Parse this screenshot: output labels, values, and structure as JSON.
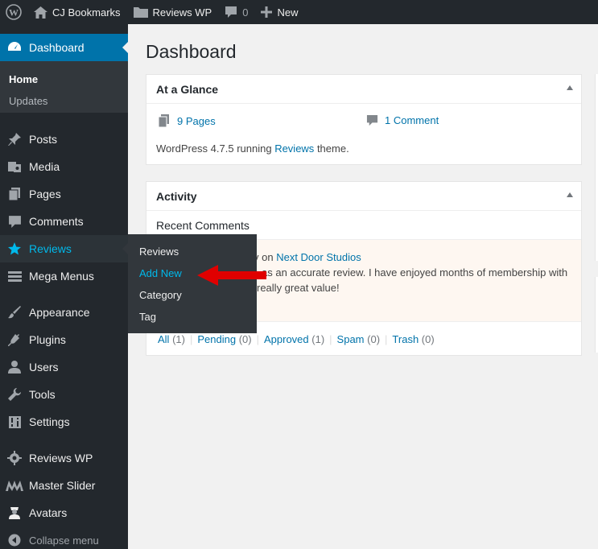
{
  "admin_bar": {
    "site_name": "CJ Bookmarks",
    "plugin_name": "Reviews WP",
    "comment_count": "0",
    "new_label": "New"
  },
  "sidebar": {
    "dashboard": "Dashboard",
    "submenu": {
      "home": "Home",
      "updates": "Updates"
    },
    "items": [
      {
        "label": "Posts",
        "icon": "pin-icon"
      },
      {
        "label": "Media",
        "icon": "media-icon"
      },
      {
        "label": "Pages",
        "icon": "pages-icon"
      },
      {
        "label": "Comments",
        "icon": "comment-icon"
      },
      {
        "label": "Reviews",
        "icon": "star-icon"
      },
      {
        "label": "Mega Menus",
        "icon": "menu-icon"
      },
      {
        "label": "Appearance",
        "icon": "brush-icon"
      },
      {
        "label": "Plugins",
        "icon": "plug-icon"
      },
      {
        "label": "Users",
        "icon": "user-icon"
      },
      {
        "label": "Tools",
        "icon": "wrench-icon"
      },
      {
        "label": "Settings",
        "icon": "settings-icon"
      },
      {
        "label": "Reviews WP",
        "icon": "gear-icon"
      },
      {
        "label": "Master Slider",
        "icon": "slider-icon"
      },
      {
        "label": "Avatars",
        "icon": "avatar-icon"
      }
    ],
    "collapse": "Collapse menu"
  },
  "flyout": {
    "items": [
      "Reviews",
      "Add New",
      "Category",
      "Tag"
    ]
  },
  "main": {
    "title": "Dashboard",
    "glance": {
      "title": "At a Glance",
      "pages": "9 Pages",
      "comments": "1 Comment",
      "version_text": "WordPress 4.7.5 running",
      "theme_link": "Reviews",
      "theme_suffix": "theme."
    },
    "activity": {
      "title": "Activity",
      "recent": "Recent Comments",
      "comment_prefix": "y on",
      "comment_post": "Next Door Studios",
      "comment_line1": "as an accurate review. I have enjoyed months of membership with",
      "comment_line2": "really great value!",
      "filters": [
        {
          "label": "All",
          "count": "(1)"
        },
        {
          "label": "Pending",
          "count": "(0)"
        },
        {
          "label": "Approved",
          "count": "(1)"
        },
        {
          "label": "Spam",
          "count": "(0)"
        },
        {
          "label": "Trash",
          "count": "(0)"
        }
      ]
    }
  },
  "colors": {
    "sidebar_bg": "#23282d",
    "active_bg": "#0073aa",
    "link": "#0073aa",
    "highlight": "#00b9eb",
    "arrow": "#e00000"
  }
}
